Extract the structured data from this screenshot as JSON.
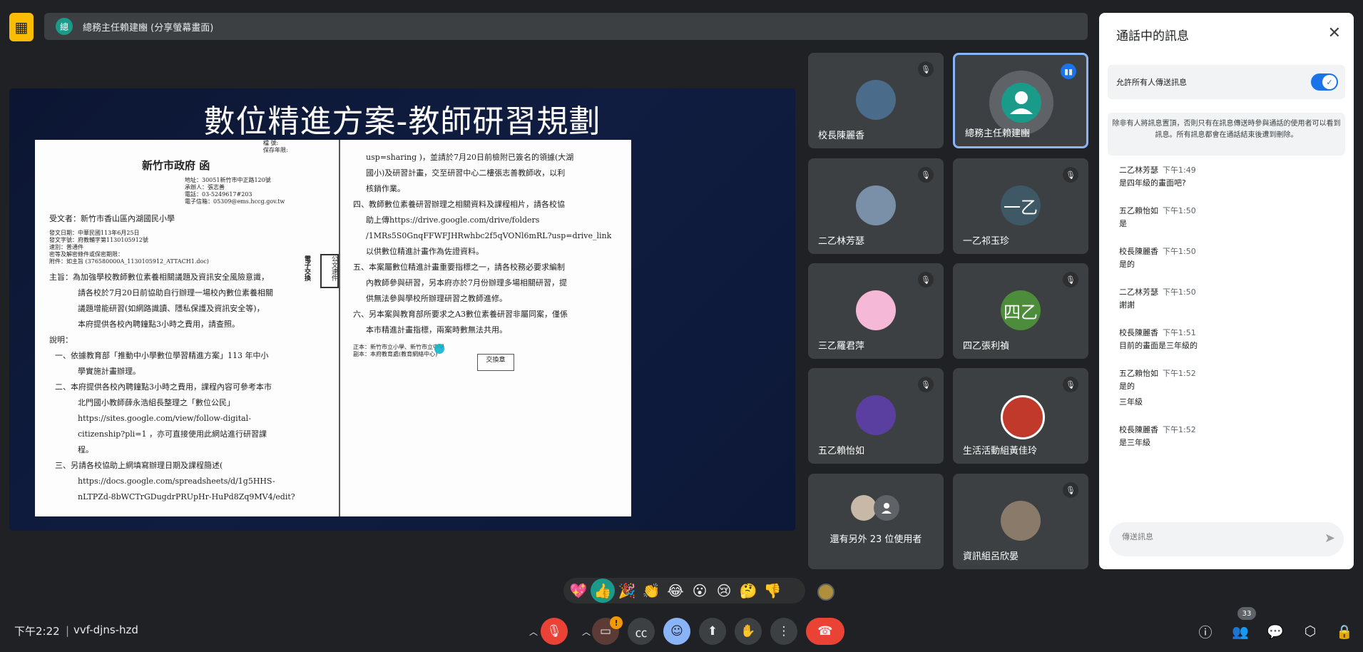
{
  "presenter_bar": {
    "label": "總務主任賴建豳 (分享螢幕畫面)",
    "avatar_initial": "總"
  },
  "slide": {
    "title": "數位精進方案-教師研習規劃",
    "doc_left": {
      "meta_top": [
        "檔    號:",
        "保存年限:"
      ],
      "agency": "新竹市政府  函",
      "address": [
        "地址：30051新竹市中正路120號",
        "承辦人：張志善",
        "電話：03-5249617#203",
        "電子信箱：05309@ems.hccg.gov.tw"
      ],
      "recipient": "受文者：新竹市香山區內湖國民小學",
      "dispatch": [
        "發文日期：中華民國113年6月25日",
        "發文字號：府教輔字第1130105912號",
        "速別：普通件",
        "密等及解密條件或保密期限：",
        "附件：如主旨 (376580000A_1130105912_ATTACH1.doc)"
      ],
      "subject": [
        "主旨：為加強學校教師數位素養相關議題及資訊安全風險意識，",
        "請各校於7月20日前協助自行辦理一場校內數位素養相關",
        "議題增能研習(如網路識讀、隱私保護及資訊安全等)，",
        "本府提供各校內聘鐘點3小時之費用，請查照。"
      ],
      "desc_label": "說明：",
      "items": [
        "一、依據教育部「推動中小學數位學習精進方案」113 年中小",
        "學實施計畫辦理。",
        "二、本府提供各校內聘鐘點3小時之費用，課程內容可參考本市",
        "北門國小教師薛永浩組長整理之「數位公民」",
        "https://sites.google.com/view/follow-digital-",
        "citizenship?pli=1 ，亦可直接使用此網站進行研習課",
        "程。",
        "三、另請各校協助上網填寫辦理日期及課程簡述(",
        "https://docs.google.com/spreadsheets/d/1g5HHS-",
        "nLTPZd-8bWCTrGDugdrPRUpHr-HuPd8Zq9MV4/edit?"
      ],
      "stamp": "公文速件",
      "stamp2": "電子交換"
    },
    "doc_right": {
      "lines": [
        "usp=sharing )，並請於7月20日前檢附已簽名的領據(大湖",
        "國小)及研習計畫，交至研習中心二樓張志善教師收，以利",
        "核銷作業。",
        "四、教師數位素養研習辦理之相關資料及課程相片，請各校協",
        "助上傳https://drive.google.com/drive/folders",
        "/1MRs5S0GnqFFWFJHRwhbc2f5qVONl6mRL?usp=drive_link",
        "以供數位精進計畫作為佐證資料。",
        "五、本案屬數位精進計畫重要指標之一，請各校務必要求編制",
        "內教師參與研習，另本府亦於7月份辦理多場相關研習，提",
        "供無法參與學校所辦理研習之教師進修。",
        "六、另本案與教育部所要求之A3數位素養研習非屬同案，僅係",
        "本市精進計畫指標，兩案時數無法共用。"
      ],
      "cc": [
        "正本：新竹市立小學、新竹市立中學",
        "副本：本府教育處(教育網絡中心)"
      ],
      "seal": "交換章"
    }
  },
  "participants": [
    {
      "name": "校長陳麗香",
      "muted": true,
      "avatar_text": "",
      "color": "#4a6b8a"
    },
    {
      "name": "總務主任賴建豳",
      "muted": false,
      "speaking": true,
      "avatar_text": "",
      "color": "#1a9b8a"
    },
    {
      "name": "二乙林芳瑟",
      "muted": true,
      "avatar_text": "",
      "color": "#7a8fa8"
    },
    {
      "name": "一乙祁玉珍",
      "muted": true,
      "avatar_text": "一乙",
      "color": "#3f5866"
    },
    {
      "name": "三乙羅君萍",
      "muted": true,
      "avatar_text": "",
      "color": "#f5b8d6"
    },
    {
      "name": "四乙張利禎",
      "muted": true,
      "avatar_text": "四乙",
      "color": "#4c8c3a"
    },
    {
      "name": "五乙賴怡如",
      "muted": true,
      "avatar_text": "",
      "color": "#5b3fa0"
    },
    {
      "name": "生活活動組黃佳玲",
      "muted": true,
      "avatar_text": "",
      "color": "#c0392b"
    },
    {
      "name": "還有另外 23 位使用者",
      "muted": false,
      "avatar_text": "",
      "color": "#5f6368"
    },
    {
      "name": "資訊組呂欣晏",
      "muted": true,
      "avatar_text": "",
      "color": "#8a7a6a"
    }
  ],
  "chat": {
    "title": "通話中的訊息",
    "allow_label": "允許所有人傳送訊息",
    "notice": "除非有人將訊息置頂，否則只有在訊息傳送時參與通話的使用者可以看到訊息。所有訊息都會在通話結束後遭到刪除。",
    "messages": [
      {
        "sender": "二乙林芳瑟",
        "time": "下午1:49",
        "lines": [
          "是四年級的畫面吧?"
        ]
      },
      {
        "sender": "五乙賴怡如",
        "time": "下午1:50",
        "lines": [
          "是"
        ]
      },
      {
        "sender": "校長陳麗香",
        "time": "下午1:50",
        "lines": [
          "是的"
        ]
      },
      {
        "sender": "二乙林芳瑟",
        "time": "下午1:50",
        "lines": [
          "謝謝"
        ]
      },
      {
        "sender": "校長陳麗香",
        "time": "下午1:51",
        "lines": [
          "目前的畫面是三年級的"
        ]
      },
      {
        "sender": "五乙賴怡如",
        "time": "下午1:52",
        "lines": [
          "是的",
          "三年級"
        ]
      },
      {
        "sender": "校長陳麗香",
        "time": "下午1:52",
        "lines": [
          "是三年級"
        ]
      }
    ],
    "input_placeholder": "傳送訊息"
  },
  "reactions": [
    "💖",
    "👍",
    "🎉",
    "👏",
    "😂",
    "😮",
    "😢",
    "🤔",
    "👎"
  ],
  "bottom": {
    "clock": "下午2:22",
    "separator": "|",
    "meeting_code": "vvf-djns-hzd",
    "people_count": "33",
    "camera_warning": "!"
  }
}
